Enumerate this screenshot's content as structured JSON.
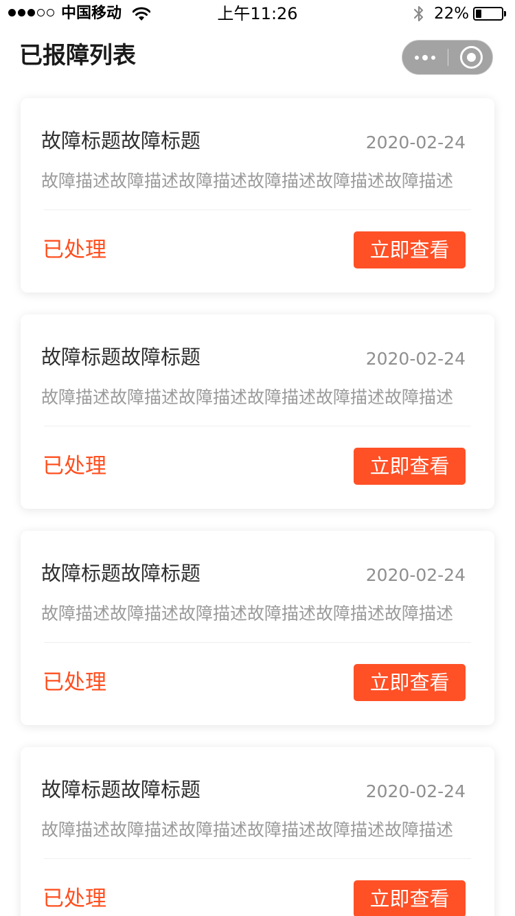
{
  "status_bar": {
    "carrier": "中国移动",
    "time": "上午11:26",
    "battery_percent": "22%",
    "battery_level": 0.22,
    "signal_bars_filled": 3,
    "signal_bars_total": 5,
    "icons": [
      "signal-dots-icon",
      "wifi-icon",
      "bluetooth-icon",
      "battery-icon"
    ]
  },
  "nav": {
    "title": "已报障列表",
    "capsule_icons": [
      "more-icon",
      "close-target-icon"
    ]
  },
  "colors": {
    "accent": "#ff5026",
    "status_text": "#ff4f1f",
    "title_text": "#2f2f2f",
    "secondary_text": "#9a9a9a",
    "capsule_bg": "#a3a3a3"
  },
  "fault_list": [
    {
      "title": "故障标题故障标题",
      "date": "2020-02-24",
      "description": "故障描述故障描述故障描述故障描述故障描述故障描述",
      "status": "已处理",
      "action_label": "立即查看"
    },
    {
      "title": "故障标题故障标题",
      "date": "2020-02-24",
      "description": "故障描述故障描述故障描述故障描述故障描述故障描述",
      "status": "已处理",
      "action_label": "立即查看"
    },
    {
      "title": "故障标题故障标题",
      "date": "2020-02-24",
      "description": "故障描述故障描述故障描述故障描述故障描述故障描述",
      "status": "已处理",
      "action_label": "立即查看"
    },
    {
      "title": "故障标题故障标题",
      "date": "2020-02-24",
      "description": "故障描述故障描述故障描述故障描述故障描述故障描述",
      "status": "已处理",
      "action_label": "立即查看"
    }
  ]
}
